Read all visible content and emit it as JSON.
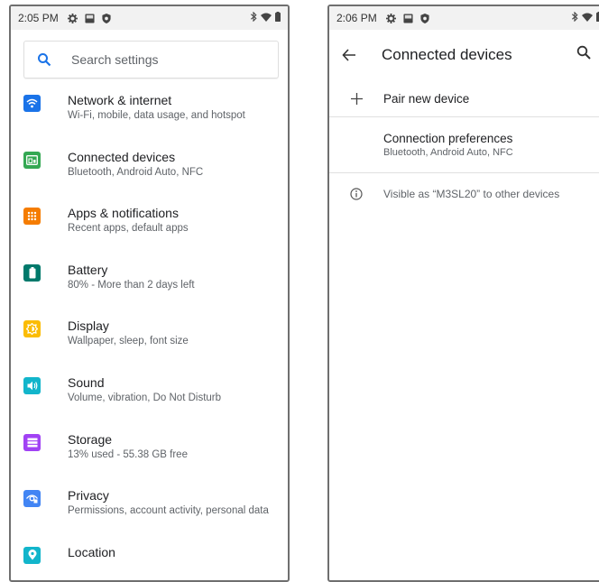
{
  "left": {
    "status": {
      "time": "2:05 PM"
    },
    "search": {
      "placeholder": "Search settings"
    },
    "items": [
      {
        "title": "Network & internet",
        "subtitle": "Wi-Fi, mobile, data usage, and hotspot",
        "icon": "wifi-icon",
        "color": "#1a73e8"
      },
      {
        "title": "Connected devices",
        "subtitle": "Bluetooth, Android Auto, NFC",
        "icon": "connected-devices-icon",
        "color": "#34a853"
      },
      {
        "title": "Apps & notifications",
        "subtitle": "Recent apps, default apps",
        "icon": "apps-grid-icon",
        "color": "#f57c00"
      },
      {
        "title": "Battery",
        "subtitle": "80% - More than 2 days left",
        "icon": "battery-icon",
        "color": "#00796b"
      },
      {
        "title": "Display",
        "subtitle": "Wallpaper, sleep, font size",
        "icon": "brightness-icon",
        "color": "#fbbc04"
      },
      {
        "title": "Sound",
        "subtitle": "Volume, vibration, Do Not Disturb",
        "icon": "volume-icon",
        "color": "#12b5cb"
      },
      {
        "title": "Storage",
        "subtitle": "13% used - 55.38 GB free",
        "icon": "storage-icon",
        "color": "#a142f4"
      },
      {
        "title": "Privacy",
        "subtitle": "Permissions, account activity, personal data",
        "icon": "privacy-icon",
        "color": "#4285f4"
      },
      {
        "title": "Location",
        "subtitle": "",
        "icon": "location-icon",
        "color": "#12b5cb"
      }
    ]
  },
  "right": {
    "status": {
      "time": "2:06 PM"
    },
    "appbar": {
      "title": "Connected devices"
    },
    "pair": {
      "label": "Pair new device"
    },
    "prefs": {
      "title": "Connection preferences",
      "subtitle": "Bluetooth, Android Auto, NFC"
    },
    "visible": {
      "text": "Visible as “M3SL20” to other devices"
    }
  }
}
